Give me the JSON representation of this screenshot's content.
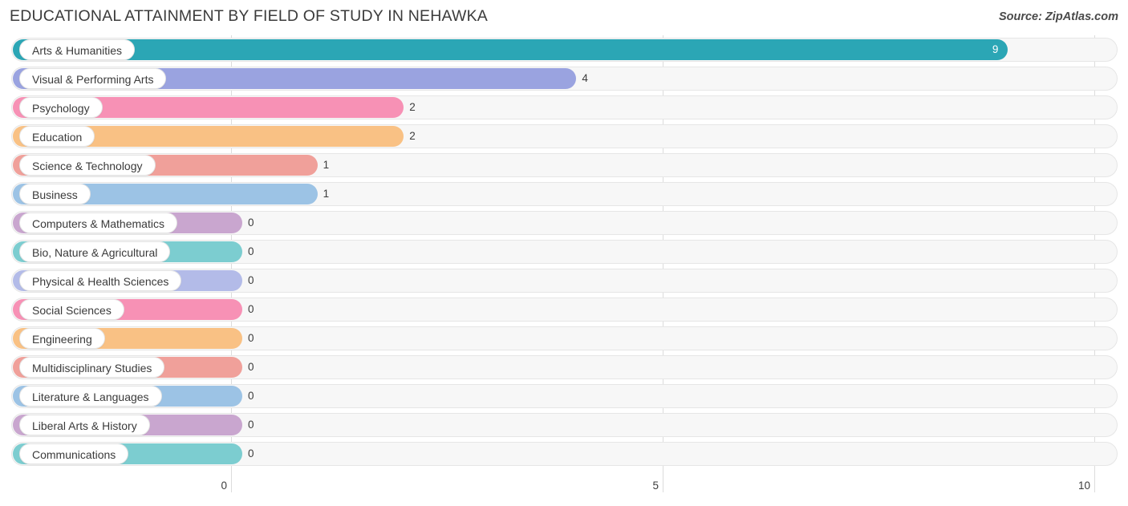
{
  "header": {
    "title": "EDUCATIONAL ATTAINMENT BY FIELD OF STUDY IN NEHAWKA",
    "source": "Source: ZipAtlas.com"
  },
  "chart_data": {
    "type": "bar",
    "orientation": "horizontal",
    "title": "EDUCATIONAL ATTAINMENT BY FIELD OF STUDY IN NEHAWKA",
    "xlabel": "",
    "ylabel": "",
    "xlim": [
      0,
      10
    ],
    "xticks": [
      0,
      5,
      10
    ],
    "xtick_labels": [
      "0",
      "5",
      "10"
    ],
    "grid": true,
    "legend": false,
    "categories": [
      "Arts & Humanities",
      "Visual & Performing Arts",
      "Psychology",
      "Education",
      "Science & Technology",
      "Business",
      "Computers & Mathematics",
      "Bio, Nature & Agricultural",
      "Physical & Health Sciences",
      "Social Sciences",
      "Engineering",
      "Multidisciplinary Studies",
      "Literature & Languages",
      "Liberal Arts & History",
      "Communications"
    ],
    "values": [
      9,
      4,
      2,
      2,
      1,
      1,
      0,
      0,
      0,
      0,
      0,
      0,
      0,
      0,
      0
    ],
    "value_labels": [
      "9",
      "4",
      "2",
      "2",
      "1",
      "1",
      "0",
      "0",
      "0",
      "0",
      "0",
      "0",
      "0",
      "0",
      "0"
    ],
    "colors": [
      "#2ba6b5",
      "#9aa3e0",
      "#f braces",
      "#f9c184",
      "#f0a09a",
      "#9cc3e5",
      "#c9a6cf",
      "#7ccdd0",
      "#b3bbe8",
      "#f791b5",
      "#f9c184",
      "#f0a09a",
      "#9cc3e5",
      "#c9a6cf",
      "#7ccdd0"
    ]
  },
  "rows": [
    {
      "label": "Arts & Humanities",
      "value": 9,
      "value_label": "9",
      "color": "#2ba6b5",
      "label_inside_bar": true
    },
    {
      "label": "Visual & Performing Arts",
      "value": 4,
      "value_label": "4",
      "color": "#9aa3e0",
      "label_inside_bar": false
    },
    {
      "label": "Psychology",
      "value": 2,
      "value_label": "2",
      "color": "#f791b5",
      "label_inside_bar": false
    },
    {
      "label": "Education",
      "value": 2,
      "value_label": "2",
      "color": "#f9c184",
      "label_inside_bar": false
    },
    {
      "label": "Science & Technology",
      "value": 1,
      "value_label": "1",
      "color": "#f0a09a",
      "label_inside_bar": false
    },
    {
      "label": "Business",
      "value": 1,
      "value_label": "1",
      "color": "#9cc3e5",
      "label_inside_bar": false
    },
    {
      "label": "Computers & Mathematics",
      "value": 0,
      "value_label": "0",
      "color": "#c9a6cf",
      "label_inside_bar": false
    },
    {
      "label": "Bio, Nature & Agricultural",
      "value": 0,
      "value_label": "0",
      "color": "#7ccdd0",
      "label_inside_bar": false
    },
    {
      "label": "Physical & Health Sciences",
      "value": 0,
      "value_label": "0",
      "color": "#b3bbe8",
      "label_inside_bar": false
    },
    {
      "label": "Social Sciences",
      "value": 0,
      "value_label": "0",
      "color": "#f791b5",
      "label_inside_bar": false
    },
    {
      "label": "Engineering",
      "value": 0,
      "value_label": "0",
      "color": "#f9c184",
      "label_inside_bar": false
    },
    {
      "label": "Multidisciplinary Studies",
      "value": 0,
      "value_label": "0",
      "color": "#f0a09a",
      "label_inside_bar": false
    },
    {
      "label": "Literature & Languages",
      "value": 0,
      "value_label": "0",
      "color": "#9cc3e5",
      "label_inside_bar": false
    },
    {
      "label": "Liberal Arts & History",
      "value": 0,
      "value_label": "0",
      "color": "#c9a6cf",
      "label_inside_bar": false
    },
    {
      "label": "Communications",
      "value": 0,
      "value_label": "0",
      "color": "#7ccdd0",
      "label_inside_bar": false
    }
  ],
  "axis": {
    "ticks": [
      {
        "label": "0",
        "value": 0
      },
      {
        "label": "5",
        "value": 5
      },
      {
        "label": "10",
        "value": 10
      }
    ]
  }
}
